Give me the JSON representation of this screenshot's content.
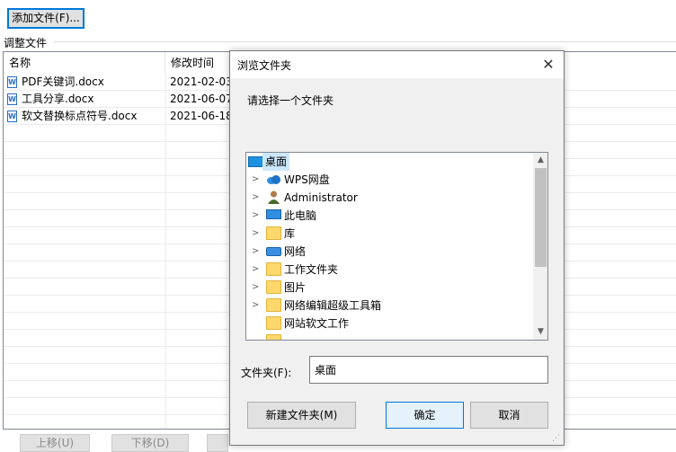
{
  "main": {
    "add_button": "添加文件(F)...",
    "group_label": "调整文件",
    "columns": [
      "名称",
      "修改时间"
    ],
    "files": [
      {
        "name": "PDF关键词.docx",
        "date": "2021-02-03"
      },
      {
        "name": "工具分享.docx",
        "date": "2021-06-07"
      },
      {
        "name": "软文替换标点符号.docx",
        "date": "2021-06-18"
      }
    ],
    "move_up": "上移(U)",
    "move_down": "下移(D)"
  },
  "dialog": {
    "title": "浏览文件夹",
    "close_glyph": "✕",
    "prompt": "请选择一个文件夹",
    "tree": [
      {
        "label": "桌面",
        "icon": "desktop-icon",
        "expandable": false,
        "selected": true
      },
      {
        "label": "WPS网盘",
        "icon": "cloud-icon",
        "expandable": true
      },
      {
        "label": "Administrator",
        "icon": "user-icon",
        "expandable": true
      },
      {
        "label": "此电脑",
        "icon": "computer-icon",
        "expandable": true
      },
      {
        "label": "库",
        "icon": "library-icon",
        "expandable": true
      },
      {
        "label": "网络",
        "icon": "network-icon",
        "expandable": true
      },
      {
        "label": "工作文件夹",
        "icon": "folder-icon",
        "expandable": true
      },
      {
        "label": "图片",
        "icon": "folder-icon",
        "expandable": true
      },
      {
        "label": "网络编辑超级工具箱",
        "icon": "folder-icon",
        "expandable": true
      },
      {
        "label": "网站软文工作",
        "icon": "folder-icon",
        "expandable": false
      }
    ],
    "folder_label": "文件夹(F):",
    "folder_value": "桌面",
    "new_folder_button": "新建文件夹(M)",
    "ok_button": "确定",
    "cancel_button": "取消"
  },
  "colors": {
    "accent": "#0078d7",
    "selection": "#cce8ff",
    "folder": "#ffd86b"
  }
}
